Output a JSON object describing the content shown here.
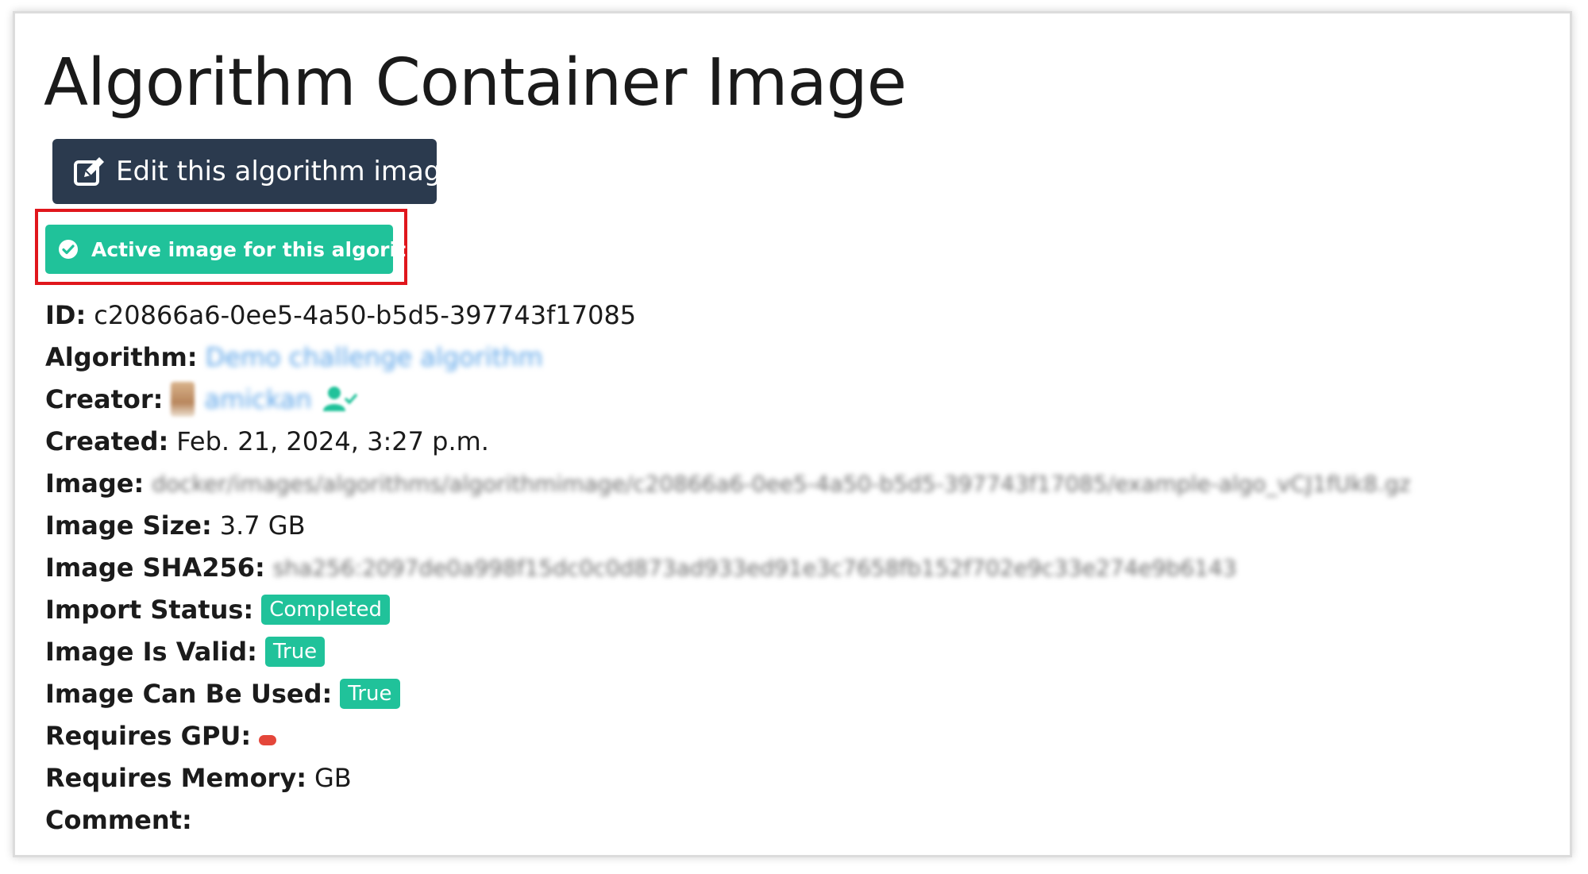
{
  "page": {
    "title": "Algorithm Container Image"
  },
  "edit_button": {
    "label": "Edit this algorithm image",
    "icon": "edit-icon"
  },
  "active_badge": {
    "label": "Active image for this algorithm",
    "icon": "check-circle-icon"
  },
  "details": {
    "id": {
      "label": "ID:",
      "value": "c20866a6-0ee5-4a50-b5d5-397743f17085"
    },
    "algorithm": {
      "label": "Algorithm:",
      "value": "Demo challenge algorithm"
    },
    "creator": {
      "label": "Creator:",
      "value": "amickan",
      "icon": "user-check-icon"
    },
    "created": {
      "label": "Created:",
      "value": "Feb. 21, 2024, 3:27 p.m."
    },
    "image": {
      "label": "Image:",
      "value": "docker/images/algorithms/algorithmimage/c20866a6-0ee5-4a50-b5d5-397743f17085/example-algo_vCJ1fUk8.gz"
    },
    "image_size": {
      "label": "Image Size:",
      "value": "3.7 GB"
    },
    "image_sha256": {
      "label": "Image SHA256:",
      "value": "sha256:2097de0a998f15dc0c0d873ad933ed91e3c7658fb152f702e9c33e274e9b6143"
    },
    "import_status": {
      "label": "Import Status:",
      "value": "Completed"
    },
    "image_is_valid": {
      "label": "Image Is Valid:",
      "value": "True"
    },
    "image_can_be_used": {
      "label": "Image Can Be Used:",
      "value": "True"
    },
    "requires_gpu": {
      "label": "Requires GPU:",
      "value_color": "#e4463a"
    },
    "requires_memory": {
      "label": "Requires Memory:",
      "value": "GB"
    },
    "comment": {
      "label": "Comment:",
      "value": ""
    }
  },
  "colors": {
    "primary_dark": "#2b3a4e",
    "success": "#20c29a",
    "link": "#5aa3e8",
    "highlight": "#e0161c"
  }
}
